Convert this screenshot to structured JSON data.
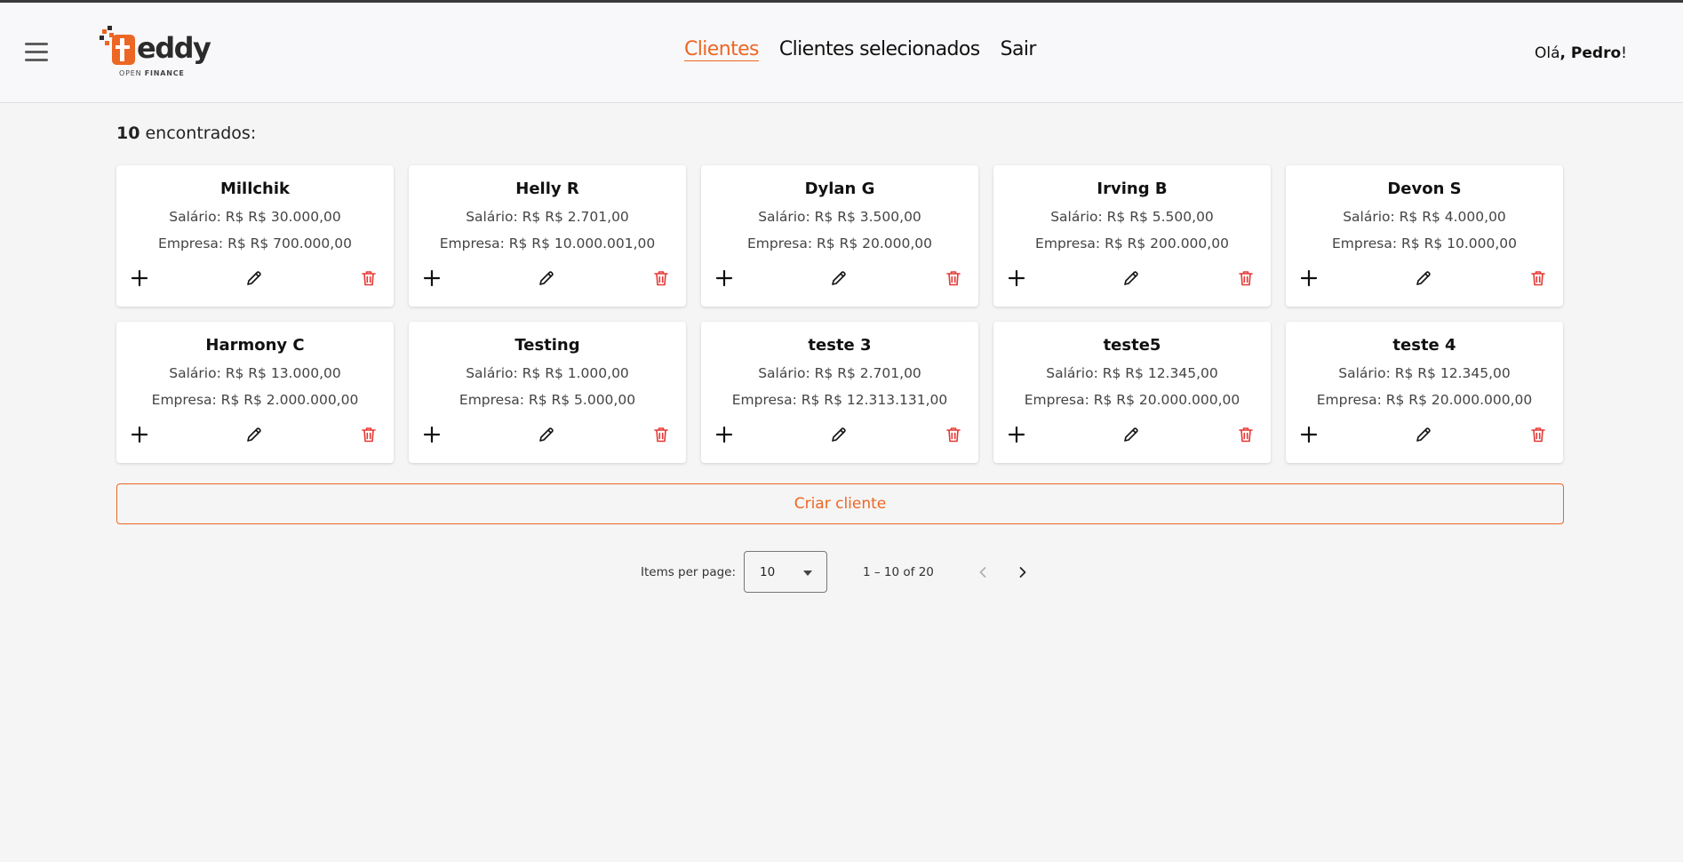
{
  "header": {
    "logo": {
      "word": "eddy",
      "sub_light": "OPEN ",
      "sub_bold": "FINANCE"
    },
    "nav": [
      {
        "label": "Clientes",
        "active": true
      },
      {
        "label": "Clientes selecionados",
        "active": false
      },
      {
        "label": "Sair",
        "active": false
      }
    ],
    "greeting": {
      "prefix": "Olá",
      "comma": ", ",
      "name": "Pedro",
      "suffix": "!"
    }
  },
  "results": {
    "count": "10",
    "label": " encontrados:"
  },
  "clients": [
    {
      "name": "Millchik",
      "salary": "Salário: R$ R$ 30.000,00",
      "company": "Empresa: R$ R$ 700.000,00"
    },
    {
      "name": "Helly R",
      "salary": "Salário: R$ R$ 2.701,00",
      "company": "Empresa: R$ R$ 10.000.001,00"
    },
    {
      "name": "Dylan G",
      "salary": "Salário: R$ R$ 3.500,00",
      "company": "Empresa: R$ R$ 20.000,00"
    },
    {
      "name": "Irving B",
      "salary": "Salário: R$ R$ 5.500,00",
      "company": "Empresa: R$ R$ 200.000,00"
    },
    {
      "name": "Devon S",
      "salary": "Salário: R$ R$ 4.000,00",
      "company": "Empresa: R$ R$ 10.000,00"
    },
    {
      "name": "Harmony C",
      "salary": "Salário: R$ R$ 13.000,00",
      "company": "Empresa: R$ R$ 2.000.000,00"
    },
    {
      "name": "Testing",
      "salary": "Salário: R$ R$ 1.000,00",
      "company": "Empresa: R$ R$ 5.000,00"
    },
    {
      "name": "teste 3",
      "salary": "Salário: R$ R$ 2.701,00",
      "company": "Empresa: R$ R$ 12.313.131,00"
    },
    {
      "name": "teste5",
      "salary": "Salário: R$ R$ 12.345,00",
      "company": "Empresa: R$ R$ 20.000.000,00"
    },
    {
      "name": "teste 4",
      "salary": "Salário: R$ R$ 12.345,00",
      "company": "Empresa: R$ R$ 20.000.000,00"
    }
  ],
  "card_icons": {
    "add": "plus-icon",
    "edit": "pencil-icon",
    "delete": "trash-icon"
  },
  "create_button": "Criar cliente",
  "pagination": {
    "items_per_page_label": "Items per page:",
    "items_per_page_value": "10",
    "range": "1 – 10 of 20",
    "prev_icon": "chevron-left-icon",
    "next_icon": "chevron-right-icon"
  },
  "colors": {
    "accent": "#ec6724",
    "delete": "#e53935",
    "background": "#f5f5f5",
    "header_bg": "#f8f8fa"
  }
}
